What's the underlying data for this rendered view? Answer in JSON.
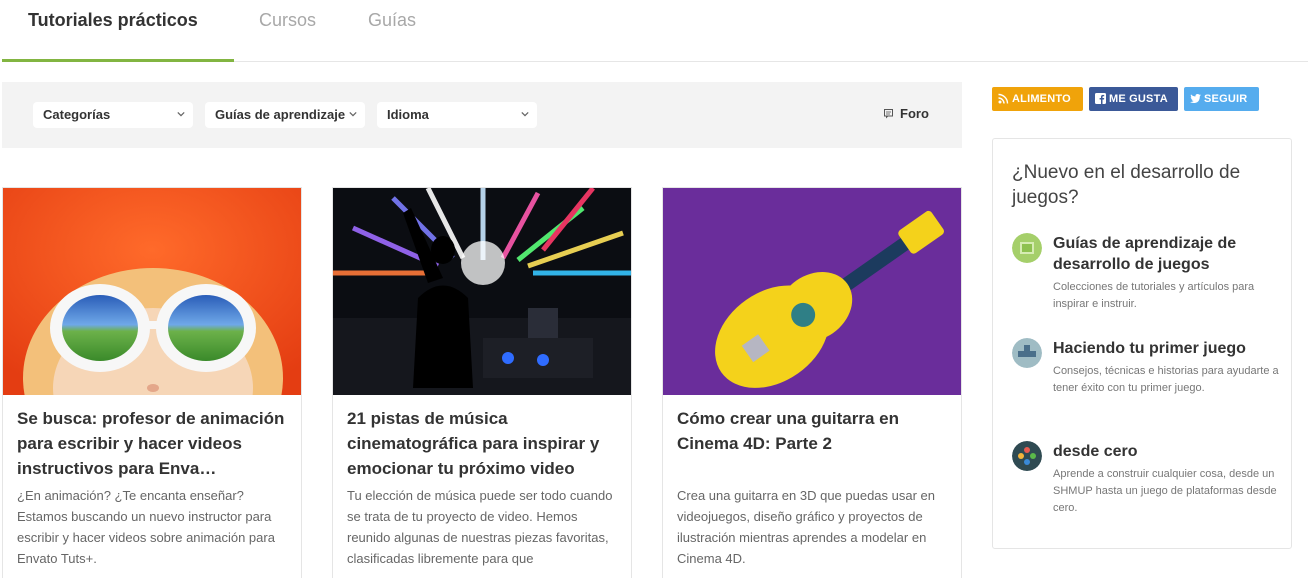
{
  "tabs": [
    {
      "label": "Tutoriales prácticos"
    },
    {
      "label": "Cursos"
    },
    {
      "label": "Guías"
    }
  ],
  "filters": {
    "categories": "Categorías",
    "guides": "Guías de aprendizaje",
    "language": "Idioma",
    "forum": "Foro"
  },
  "cards": [
    {
      "title": "Se busca: profesor de animación para escribir y hacer videos instructivos para Enva…",
      "description": "¿En animación? ¿Te encanta enseñar? Estamos buscando un nuevo instructor para escribir y hacer videos sobre animación para Envato Tuts+."
    },
    {
      "title": "21 pistas de música cinematográfica para inspirar y emocionar tu próximo video",
      "description": "Tu elección de música puede ser todo cuando se trata de tu proyecto de video. Hemos reunido algunas de nuestras piezas favoritas, clasificadas libremente para que"
    },
    {
      "title": "Cómo crear una guitarra en Cinema 4D: Parte 2",
      "description": "Crea una guitarra en 3D que puedas usar en videojuegos, diseño gráfico y proyectos de ilustración mientras aprendes a modelar en Cinema 4D."
    }
  ],
  "social": {
    "rss": "ALIMENTO",
    "facebook": "ME GUSTA",
    "twitter": "SEGUIR"
  },
  "sidebar": {
    "title": "¿Nuevo en el desarrollo de juegos?",
    "items": [
      {
        "title": "Guías de aprendizaje de desarrollo de juegos",
        "description": "Colecciones de tutoriales y artículos para inspirar e instruir."
      },
      {
        "title": "Haciendo tu primer juego",
        "description": "Consejos, técnicas e historias para ayudarte a tener éxito con tu primer juego."
      },
      {
        "title": "desde cero",
        "description": "Aprende a construir cualquier cosa, desde un SHMUP hasta un juego de plataformas desde cero."
      }
    ]
  },
  "colors": {
    "accent": "#82b541",
    "rss": "#f0a30a",
    "facebook": "#3b5998",
    "twitter": "#55acee"
  }
}
